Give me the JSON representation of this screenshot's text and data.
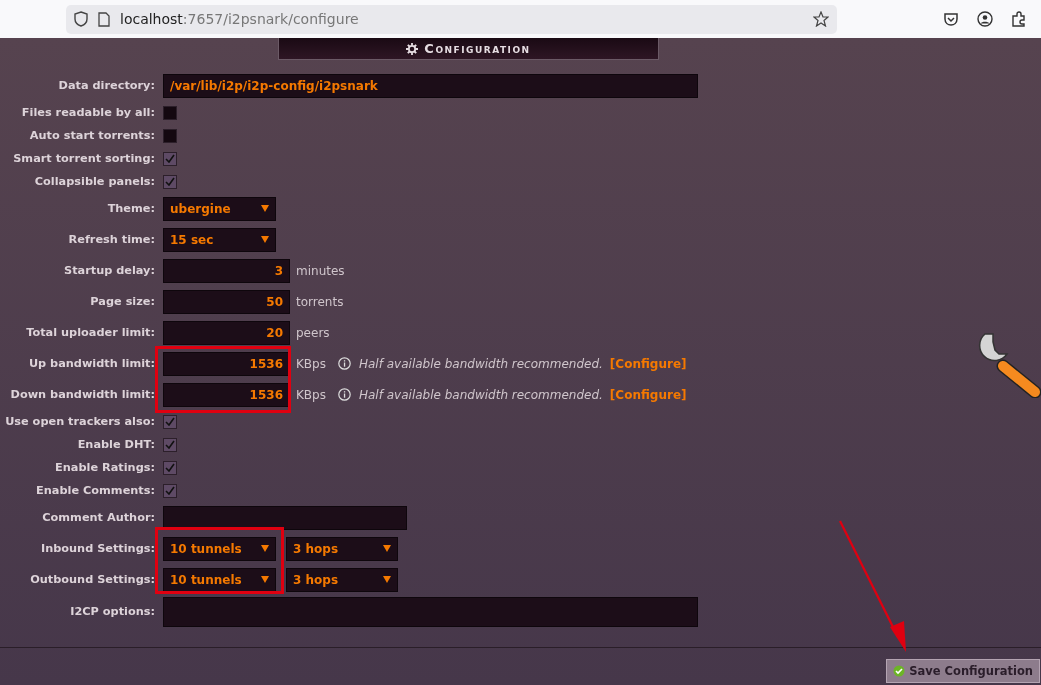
{
  "browser": {
    "url_host": "localhost",
    "url_path": ":7657/i2psnark/configure"
  },
  "title": "Configuration",
  "rows": [
    {
      "kind": "path",
      "label": "Data directory:",
      "value": "/var/lib/i2p/i2p-config/i2psnark"
    },
    {
      "kind": "checkbox",
      "label": "Files readable by all:",
      "checked": false
    },
    {
      "kind": "checkbox",
      "label": "Auto start torrents:",
      "checked": false
    },
    {
      "kind": "checkbox",
      "label": "Smart torrent sorting:",
      "checked": true
    },
    {
      "kind": "checkbox",
      "label": "Collapsible panels:",
      "checked": true
    },
    {
      "kind": "select",
      "label": "Theme:",
      "value": "ubergine"
    },
    {
      "kind": "select",
      "label": "Refresh time:",
      "value": "15 sec"
    },
    {
      "kind": "number",
      "label": "Startup delay:",
      "value": "3",
      "unit": "minutes"
    },
    {
      "kind": "number",
      "label": "Page size:",
      "value": "50",
      "unit": "torrents"
    },
    {
      "kind": "number",
      "label": "Total uploader limit:",
      "value": "20",
      "unit": "peers"
    },
    {
      "kind": "number",
      "label": "Up bandwidth limit:",
      "value": "1536",
      "unit": "KBps",
      "note": "Half available bandwidth recommended.",
      "link": "[Configure]"
    },
    {
      "kind": "number",
      "label": "Down bandwidth limit:",
      "value": "1536",
      "unit": "KBps",
      "note": "Half available bandwidth recommended.",
      "link": "[Configure]"
    },
    {
      "kind": "checkbox",
      "label": "Use open trackers also:",
      "checked": true
    },
    {
      "kind": "checkbox",
      "label": "Enable DHT:",
      "checked": true
    },
    {
      "kind": "checkbox",
      "label": "Enable Ratings:",
      "checked": true
    },
    {
      "kind": "checkbox",
      "label": "Enable Comments:",
      "checked": true
    },
    {
      "kind": "text",
      "label": "Comment Author:"
    },
    {
      "kind": "select-pair",
      "label": "Inbound Settings:",
      "values": [
        "10 tunnels",
        "3 hops"
      ]
    },
    {
      "kind": "select-pair",
      "label": "Outbound Settings:",
      "values": [
        "10 tunnels",
        "3 hops"
      ]
    },
    {
      "kind": "textarea",
      "label": "I2CP options:"
    }
  ],
  "save_button": "Save Configuration"
}
